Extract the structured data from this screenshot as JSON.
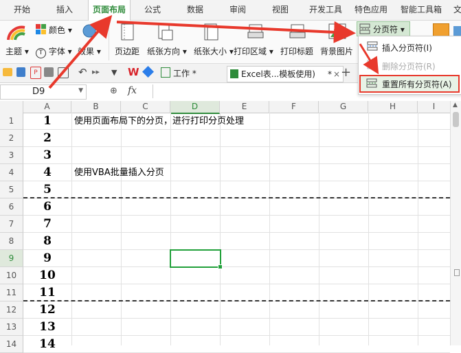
{
  "menu": {
    "items": [
      "开始",
      "插入",
      "页面布局",
      "公式",
      "数据",
      "审阅",
      "视图",
      "开发工具",
      "特色应用",
      "智能工具箱",
      "文"
    ],
    "active": "页面布局"
  },
  "ribbon": {
    "theme_label": "主题",
    "colors_label": "颜色",
    "fonts_label": "字体",
    "effects_label": "效果",
    "margins_label": "页边距",
    "orientation_label": "纸张方向",
    "size_label": "纸张大小",
    "print_area_label": "打印区域",
    "print_titles_label": "打印标题",
    "background_label": "背景图片",
    "page_break_label": "分页符"
  },
  "dropdown": {
    "insert_break": "插入分页符(I)",
    "delete_break": "删除分页符(R)",
    "reset_breaks": "重置所有分页符(A)"
  },
  "tabs": {
    "work_tab": "工作 *",
    "file_tab": "Excel表...模板使用)",
    "file_tab_modified": "*"
  },
  "formula_bar": {
    "name_box": "D9",
    "fx_label": "fx",
    "formula": ""
  },
  "columns": [
    "A",
    "B",
    "C",
    "D",
    "E",
    "F",
    "G",
    "H",
    "I"
  ],
  "rows": [
    {
      "num": "1",
      "a": "1",
      "b": "使用页面布局下的分页，进行打印分页处理"
    },
    {
      "num": "2",
      "a": "2",
      "b": ""
    },
    {
      "num": "3",
      "a": "3",
      "b": ""
    },
    {
      "num": "4",
      "a": "4",
      "b": "使用VBA批量插入分页"
    },
    {
      "num": "5",
      "a": "5",
      "b": ""
    },
    {
      "num": "6",
      "a": "6",
      "b": ""
    },
    {
      "num": "7",
      "a": "7",
      "b": ""
    },
    {
      "num": "8",
      "a": "8",
      "b": ""
    },
    {
      "num": "9",
      "a": "9",
      "b": ""
    },
    {
      "num": "10",
      "a": "10",
      "b": ""
    },
    {
      "num": "11",
      "a": "11",
      "b": ""
    },
    {
      "num": "12",
      "a": "12",
      "b": ""
    },
    {
      "num": "13",
      "a": "13",
      "b": ""
    },
    {
      "num": "14",
      "a": "14",
      "b": ""
    }
  ],
  "colors": {
    "accent": "#2e8b3a",
    "selection": "#21a03a",
    "annotation_arrow": "#e8392c"
  }
}
